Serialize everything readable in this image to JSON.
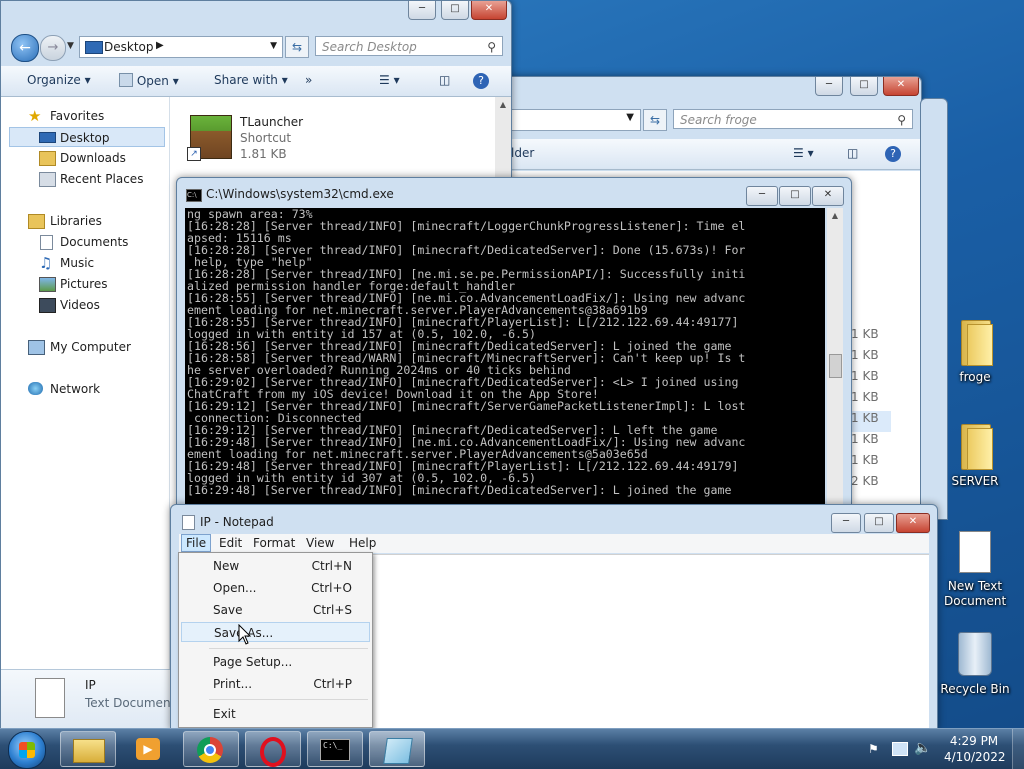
{
  "explorer1": {
    "address": "Desktop",
    "search_placeholder": "Search Desktop",
    "toolbar": {
      "organize": "Organize",
      "open": "Open",
      "share": "Share with",
      "more": "»"
    },
    "nav": {
      "favorites": "Favorites",
      "desktop": "Desktop",
      "downloads": "Downloads",
      "recent": "Recent Places",
      "libraries": "Libraries",
      "documents": "Documents",
      "music": "Music",
      "pictures": "Pictures",
      "videos": "Videos",
      "computer": "My Computer",
      "network": "Network"
    },
    "file": {
      "name": "TLauncher",
      "type": "Shortcut",
      "size": "1.81 KB"
    },
    "details": {
      "name": "IP",
      "type": "Text Document"
    }
  },
  "explorer2": {
    "search_placeholder": "Search froge",
    "toolbar_partial": "lder",
    "sizes": [
      "1 KB",
      "1 KB",
      "1 KB",
      "1 KB",
      "1 KB",
      "1 KB",
      "1 KB",
      "2 KB"
    ]
  },
  "cmd": {
    "title": "C:\\Windows\\system32\\cmd.exe",
    "lines": [
      "ng spawn area: 73%",
      "[16:28:28] [Server thread/INFO] [minecraft/LoggerChunkProgressListener]: Time el",
      "apsed: 15116 ms",
      "[16:28:28] [Server thread/INFO] [minecraft/DedicatedServer]: Done (15.673s)! For",
      " help, type \"help\"",
      "[16:28:28] [Server thread/INFO] [ne.mi.se.pe.PermissionAPI/]: Successfully initi",
      "alized permission handler forge:default_handler",
      "[16:28:55] [Server thread/INFO] [ne.mi.co.AdvancementLoadFix/]: Using new advanc",
      "ement loading for net.minecraft.server.PlayerAdvancements@38a691b9",
      "[16:28:55] [Server thread/INFO] [minecraft/PlayerList]: L[/212.122.69.44:49177]",
      "logged in with entity id 157 at (0.5, 102.0, -6.5)",
      "[16:28:56] [Server thread/INFO] [minecraft/DedicatedServer]: L joined the game",
      "[16:28:58] [Server thread/WARN] [minecraft/MinecraftServer]: Can't keep up! Is t",
      "he server overloaded? Running 2024ms or 40 ticks behind",
      "[16:29:02] [Server thread/INFO] [minecraft/DedicatedServer]: <L> I joined using",
      "ChatCraft from my iOS device! Download it on the App Store!",
      "[16:29:12] [Server thread/INFO] [minecraft/ServerGamePacketListenerImpl]: L lost",
      " connection: Disconnected",
      "[16:29:12] [Server thread/INFO] [minecraft/DedicatedServer]: L left the game",
      "[16:29:48] [Server thread/INFO] [ne.mi.co.AdvancementLoadFix/]: Using new advanc",
      "ement loading for net.minecraft.server.PlayerAdvancements@5a03e65d",
      "[16:29:48] [Server thread/INFO] [minecraft/PlayerList]: L[/212.122.69.44:49179]",
      "logged in with entity id 307 at (0.5, 102.0, -6.5)",
      "[16:29:48] [Server thread/INFO] [minecraft/DedicatedServer]: L joined the game"
    ]
  },
  "notepad": {
    "title": "IP - Notepad",
    "menu": [
      "File",
      "Edit",
      "Format",
      "View",
      "Help"
    ],
    "file_menu": [
      {
        "label": "New",
        "key": "Ctrl+N"
      },
      {
        "label": "Open...",
        "key": "Ctrl+O"
      },
      {
        "label": "Save",
        "key": "Ctrl+S"
      },
      {
        "label": "Save As...",
        "key": ""
      },
      {
        "label": "Page Setup...",
        "key": ""
      },
      {
        "label": "Print...",
        "key": "Ctrl+P"
      },
      {
        "label": "Exit",
        "key": ""
      }
    ]
  },
  "desktop_icons": [
    "froge",
    "SERVER",
    "New Text Document",
    "Recycle Bin"
  ],
  "clock": {
    "time": "4:29 PM",
    "date": "4/10/2022"
  },
  "colors": {
    "taskbar": "#2d4f75",
    "close_red": "#c64432",
    "selection": "#cce8ff",
    "console_text": "#c0c0c0"
  }
}
